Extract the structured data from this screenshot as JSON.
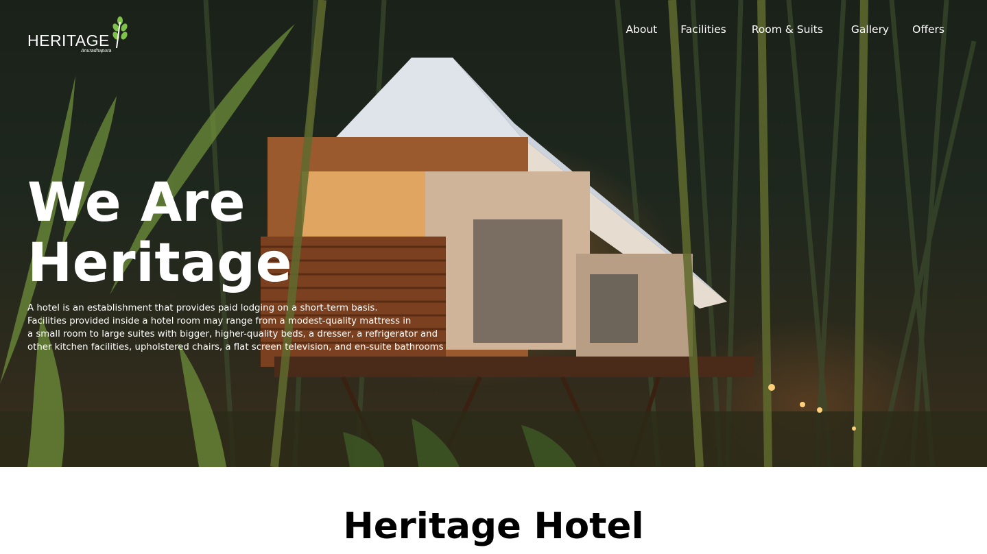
{
  "brand": {
    "name": "HERITAGE",
    "tagline": "Anuradhapura"
  },
  "nav": {
    "items": [
      {
        "label": "About"
      },
      {
        "label": "Facilities"
      },
      {
        "label": "Room & Suits"
      },
      {
        "label": "Gallery"
      },
      {
        "label": "Offers"
      }
    ]
  },
  "hero": {
    "title_line1": "We Are",
    "title_line2": "Heritage",
    "description": [
      "A hotel is an establishment that provides paid lodging on a short-term basis.",
      "Facilities provided inside a hotel room may range from a modest-quality mattress in",
      "a small room to large suites with bigger, higher-quality beds, a dresser, a refrigerator and",
      "other kitchen facilities, upholstered chairs, a flat screen television, and en-suite bathrooms"
    ]
  },
  "section": {
    "title": "Heritage Hotel"
  },
  "colors": {
    "logo_leaf": "#7fc24a",
    "text_light": "#ffffff",
    "text_dark": "#000000"
  }
}
